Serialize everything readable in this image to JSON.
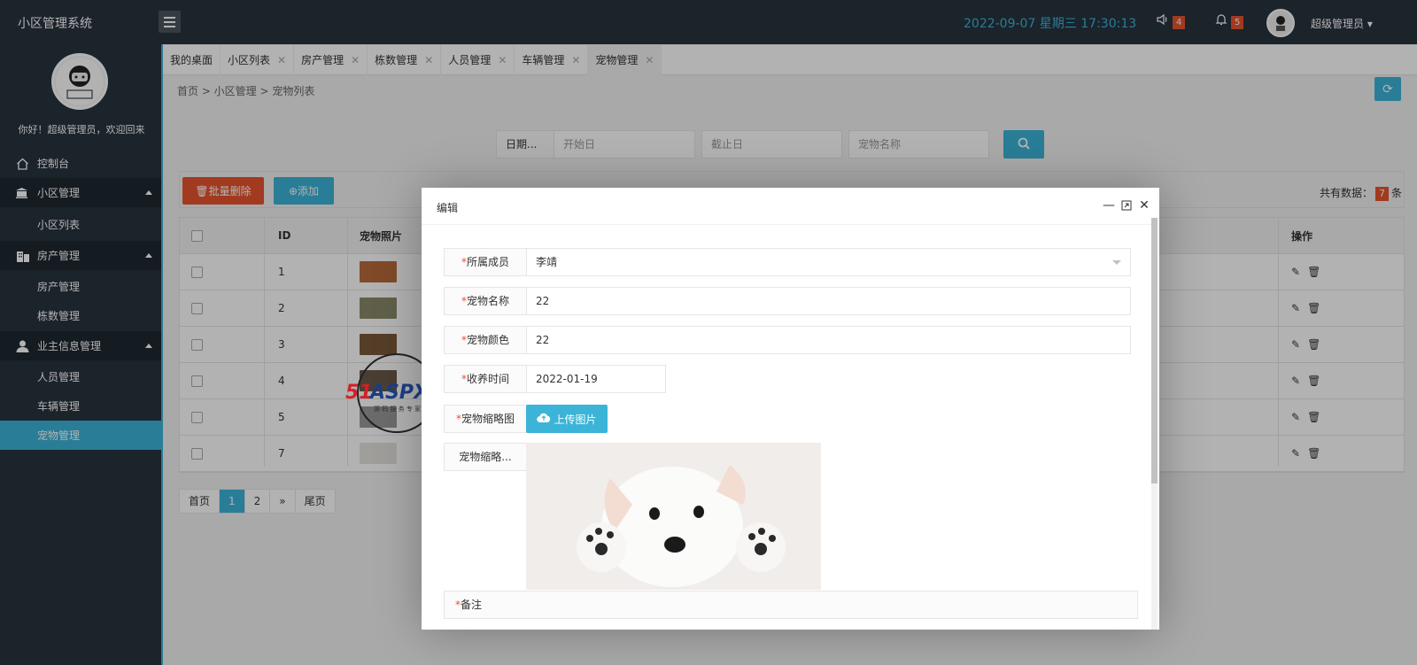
{
  "header": {
    "brand": "小区管理系统",
    "datetime": "2022-09-07   星期三   17:30:13",
    "speaker_badge": "4",
    "bell_badge": "5",
    "user": "超级管理员"
  },
  "sidebar": {
    "welcome": "你好！超级管理员，欢迎回来",
    "dashboard": "控制台",
    "groups": [
      {
        "label": "小区管理",
        "items": [
          "小区列表"
        ]
      },
      {
        "label": "房产管理",
        "items": [
          "房产管理",
          "栋数管理"
        ]
      },
      {
        "label": "业主信息管理",
        "items": [
          "人员管理",
          "车辆管理",
          "宠物管理"
        ]
      }
    ]
  },
  "tabs": [
    {
      "label": "我的桌面"
    },
    {
      "label": "小区列表"
    },
    {
      "label": "房产管理"
    },
    {
      "label": "栋数管理"
    },
    {
      "label": "人员管理"
    },
    {
      "label": "车辆管理"
    },
    {
      "label": "宠物管理"
    }
  ],
  "breadcrumb": "首页  >  小区管理  >  宠物列表",
  "search": {
    "date_label": "日期...",
    "start_placeholder": "开始日",
    "end_placeholder": "截止日",
    "name_placeholder": "宠物名称"
  },
  "toolbar": {
    "batch_delete": "批量删除",
    "add": "添加",
    "total_prefix": "共有数据：",
    "total_count": "7",
    "total_suffix": "条"
  },
  "table": {
    "headers": {
      "id": "ID",
      "photo": "宠物照片",
      "ops": "操作"
    },
    "rows": [
      {
        "id": "1",
        "thumb_color": "#b96a3b"
      },
      {
        "id": "2",
        "thumb_color": "#8a8a6a"
      },
      {
        "id": "3",
        "thumb_color": "#7a5a3a"
      },
      {
        "id": "4",
        "thumb_color": "#6b5a4a"
      },
      {
        "id": "5",
        "thumb_color": "#9a9a9a"
      },
      {
        "id": "7",
        "thumb_color": "#e6e2de"
      }
    ]
  },
  "pagination": {
    "first": "首页",
    "pages": [
      "1",
      "2"
    ],
    "next": "»",
    "last": "尾页"
  },
  "modal": {
    "title": "编辑",
    "member_label": "所属成员",
    "member_value": "李靖",
    "name_label": "宠物名称",
    "name_value": "22",
    "color_label": "宠物颜色",
    "color_value": "22",
    "date_label": "收养时间",
    "date_value": "2022-01-19",
    "thumb_label": "宠物缩略图",
    "upload_label": "上传图片",
    "thumb2_label": "宠物缩略...",
    "remark_label": "备注"
  },
  "watermark": {
    "text": "51ASPX",
    "sub": "源 码 服 务 专 家"
  },
  "colors": {
    "accent": "#3bb4d8",
    "danger": "#e8532d",
    "dark": "#28333e"
  }
}
